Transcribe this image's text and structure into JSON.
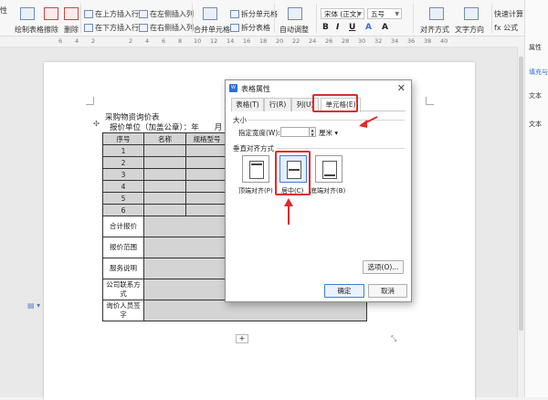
{
  "ribbon": {
    "items": [
      {
        "label": "性",
        "x": 0
      },
      {
        "label": "绘制表格"
      },
      {
        "label": "擦除"
      },
      {
        "label": "删除"
      },
      {
        "label": "在上方插入行"
      },
      {
        "label": "在下方插入行"
      },
      {
        "label": "在左侧插入列"
      },
      {
        "label": "在右侧插入列"
      },
      {
        "label": "合并单元格"
      },
      {
        "label": "拆分单元格"
      },
      {
        "label": "拆分表格"
      },
      {
        "label": "自动调整"
      },
      {
        "label": "对齐方式"
      },
      {
        "label": "文字方向"
      },
      {
        "label": "快速计算"
      },
      {
        "label": "fx 公式"
      }
    ],
    "font_name": "宋体 (正文)",
    "font_size": "五号",
    "format_buttons": [
      "B",
      "I",
      "U",
      "A",
      "A"
    ]
  },
  "ruler_ticks": [
    "6",
    "4",
    "2",
    "",
    "2",
    "4",
    "6",
    "8",
    "10",
    "12",
    "14",
    "16",
    "18",
    "20",
    "22",
    "24",
    "26",
    "28",
    "30",
    "32",
    "34",
    "36",
    "38",
    "40"
  ],
  "document": {
    "title": "采购物资询价表",
    "subtitle": "报价单位（加盖公章）：年　　月",
    "table_headers": [
      "序号",
      "名称",
      "规格型号"
    ],
    "row_numbers": [
      "1",
      "2",
      "3",
      "4",
      "5",
      "6"
    ],
    "footer_rows": [
      "合计报价",
      "报价范围",
      "服务说明",
      "公司联系方式",
      "询价人员签字"
    ]
  },
  "right_pane": {
    "title": "属性",
    "items": [
      "填充与",
      "文本",
      "文本"
    ]
  },
  "dialog": {
    "title": "表格属性",
    "tabs": [
      "表格(T)",
      "行(R)",
      "列(U)",
      "单元格(E)"
    ],
    "active_tab": "单元格(E)",
    "size_section": "大小",
    "width_label": "指定宽度(W):",
    "width_value": "",
    "width_unit": "厘米",
    "valign_section": "垂直对齐方式",
    "align_options": [
      "顶端对齐(P)",
      "居中(C)",
      "底端对齐(B)"
    ],
    "selected_align": "居中(C)",
    "options_button": "选项(O)...",
    "ok_button": "确定",
    "cancel_button": "取消"
  },
  "colors": {
    "highlight": "#e02a2a",
    "accent": "#2b6fd6",
    "table_shade": "#d4d4d4"
  }
}
